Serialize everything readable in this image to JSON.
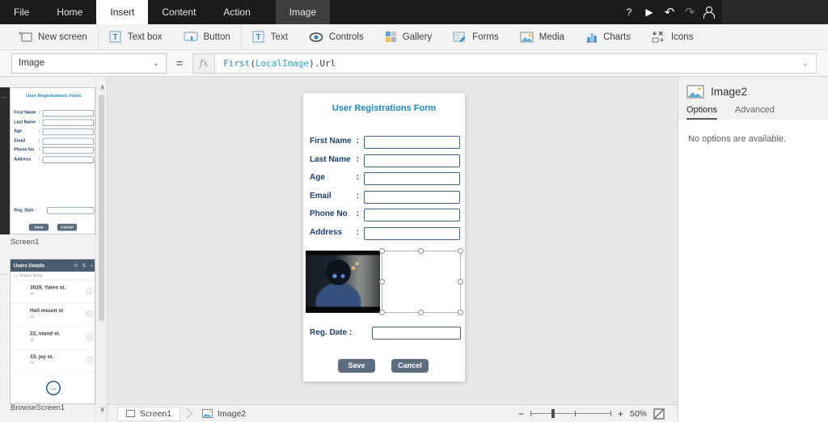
{
  "titlebar": {
    "tabs": [
      {
        "label": "File"
      },
      {
        "label": "Home"
      },
      {
        "label": "Insert"
      },
      {
        "label": "Content"
      },
      {
        "label": "Action"
      },
      {
        "label": "Image"
      }
    ],
    "active_tab": "Insert",
    "contextual_tab": "Image"
  },
  "ribbon": {
    "items": [
      {
        "label": "New screen",
        "icon": "new-screen-icon"
      },
      {
        "label": "Text box",
        "icon": "text-box-icon"
      },
      {
        "label": "Button",
        "icon": "button-icon"
      },
      {
        "label": "Text",
        "icon": "text-icon"
      },
      {
        "label": "Controls",
        "icon": "controls-icon"
      },
      {
        "label": "Gallery",
        "icon": "gallery-icon"
      },
      {
        "label": "Forms",
        "icon": "forms-icon"
      },
      {
        "label": "Media",
        "icon": "media-icon"
      },
      {
        "label": "Charts",
        "icon": "charts-icon"
      },
      {
        "label": "Icons",
        "icon": "icons-icon"
      }
    ]
  },
  "formula_bar": {
    "property_selected": "Image",
    "equals": "=",
    "fx": "fx",
    "formula": {
      "fn": "First",
      "open": "(",
      "arg": "LocalImage",
      "close": ")",
      "suffix": ".Url"
    }
  },
  "screens_panel": {
    "screens": [
      {
        "name": "Screen1"
      },
      {
        "name": "BrowseScreen1"
      }
    ]
  },
  "form": {
    "title": "User Registrations Form",
    "colon": ":",
    "fields": [
      {
        "label": "First Name"
      },
      {
        "label": "Last Name"
      },
      {
        "label": "Age"
      },
      {
        "label": "Email"
      },
      {
        "label": "Phone No"
      },
      {
        "label": "Address"
      }
    ],
    "reg_date_label": "Reg. Date :",
    "save_label": "Save",
    "cancel_label": "Cancel"
  },
  "browse_screen": {
    "header": "Users Details",
    "search_text": "Search items",
    "items": [
      {
        "title": "3028, Yates st.",
        "subtitle": "30"
      },
      {
        "title": "Hell mount st",
        "subtitle": "34"
      },
      {
        "title": "22, stand st.",
        "subtitle": "32"
      },
      {
        "title": "33, jay st.",
        "subtitle": "34"
      }
    ]
  },
  "right_panel": {
    "control_name": "Image2",
    "tabs": [
      {
        "label": "Options"
      },
      {
        "label": "Advanced"
      }
    ],
    "active_tab": "Options",
    "empty_message": "No options are available."
  },
  "status_bar": {
    "breadcrumb": [
      {
        "label": "Screen1"
      },
      {
        "label": "Image2"
      }
    ],
    "zoom_percent": "50%"
  },
  "icons": {
    "help": "?",
    "play": "▶",
    "undo": "↶",
    "redo": "↷",
    "chevron_down": "⌄",
    "ellipsis": "⋯",
    "scroll_up": "∧",
    "scroll_down": "∨",
    "minus": "−",
    "plus": "+",
    "refresh": "↻",
    "sort": "⇅",
    "row_chevron": "›",
    "arrow_right": "→"
  },
  "colors": {
    "accent_blue": "#1a87c9",
    "label_navy": "#1d3e6e",
    "button_slate": "#5b6d7e",
    "browse_header": "#4a5b6d"
  }
}
